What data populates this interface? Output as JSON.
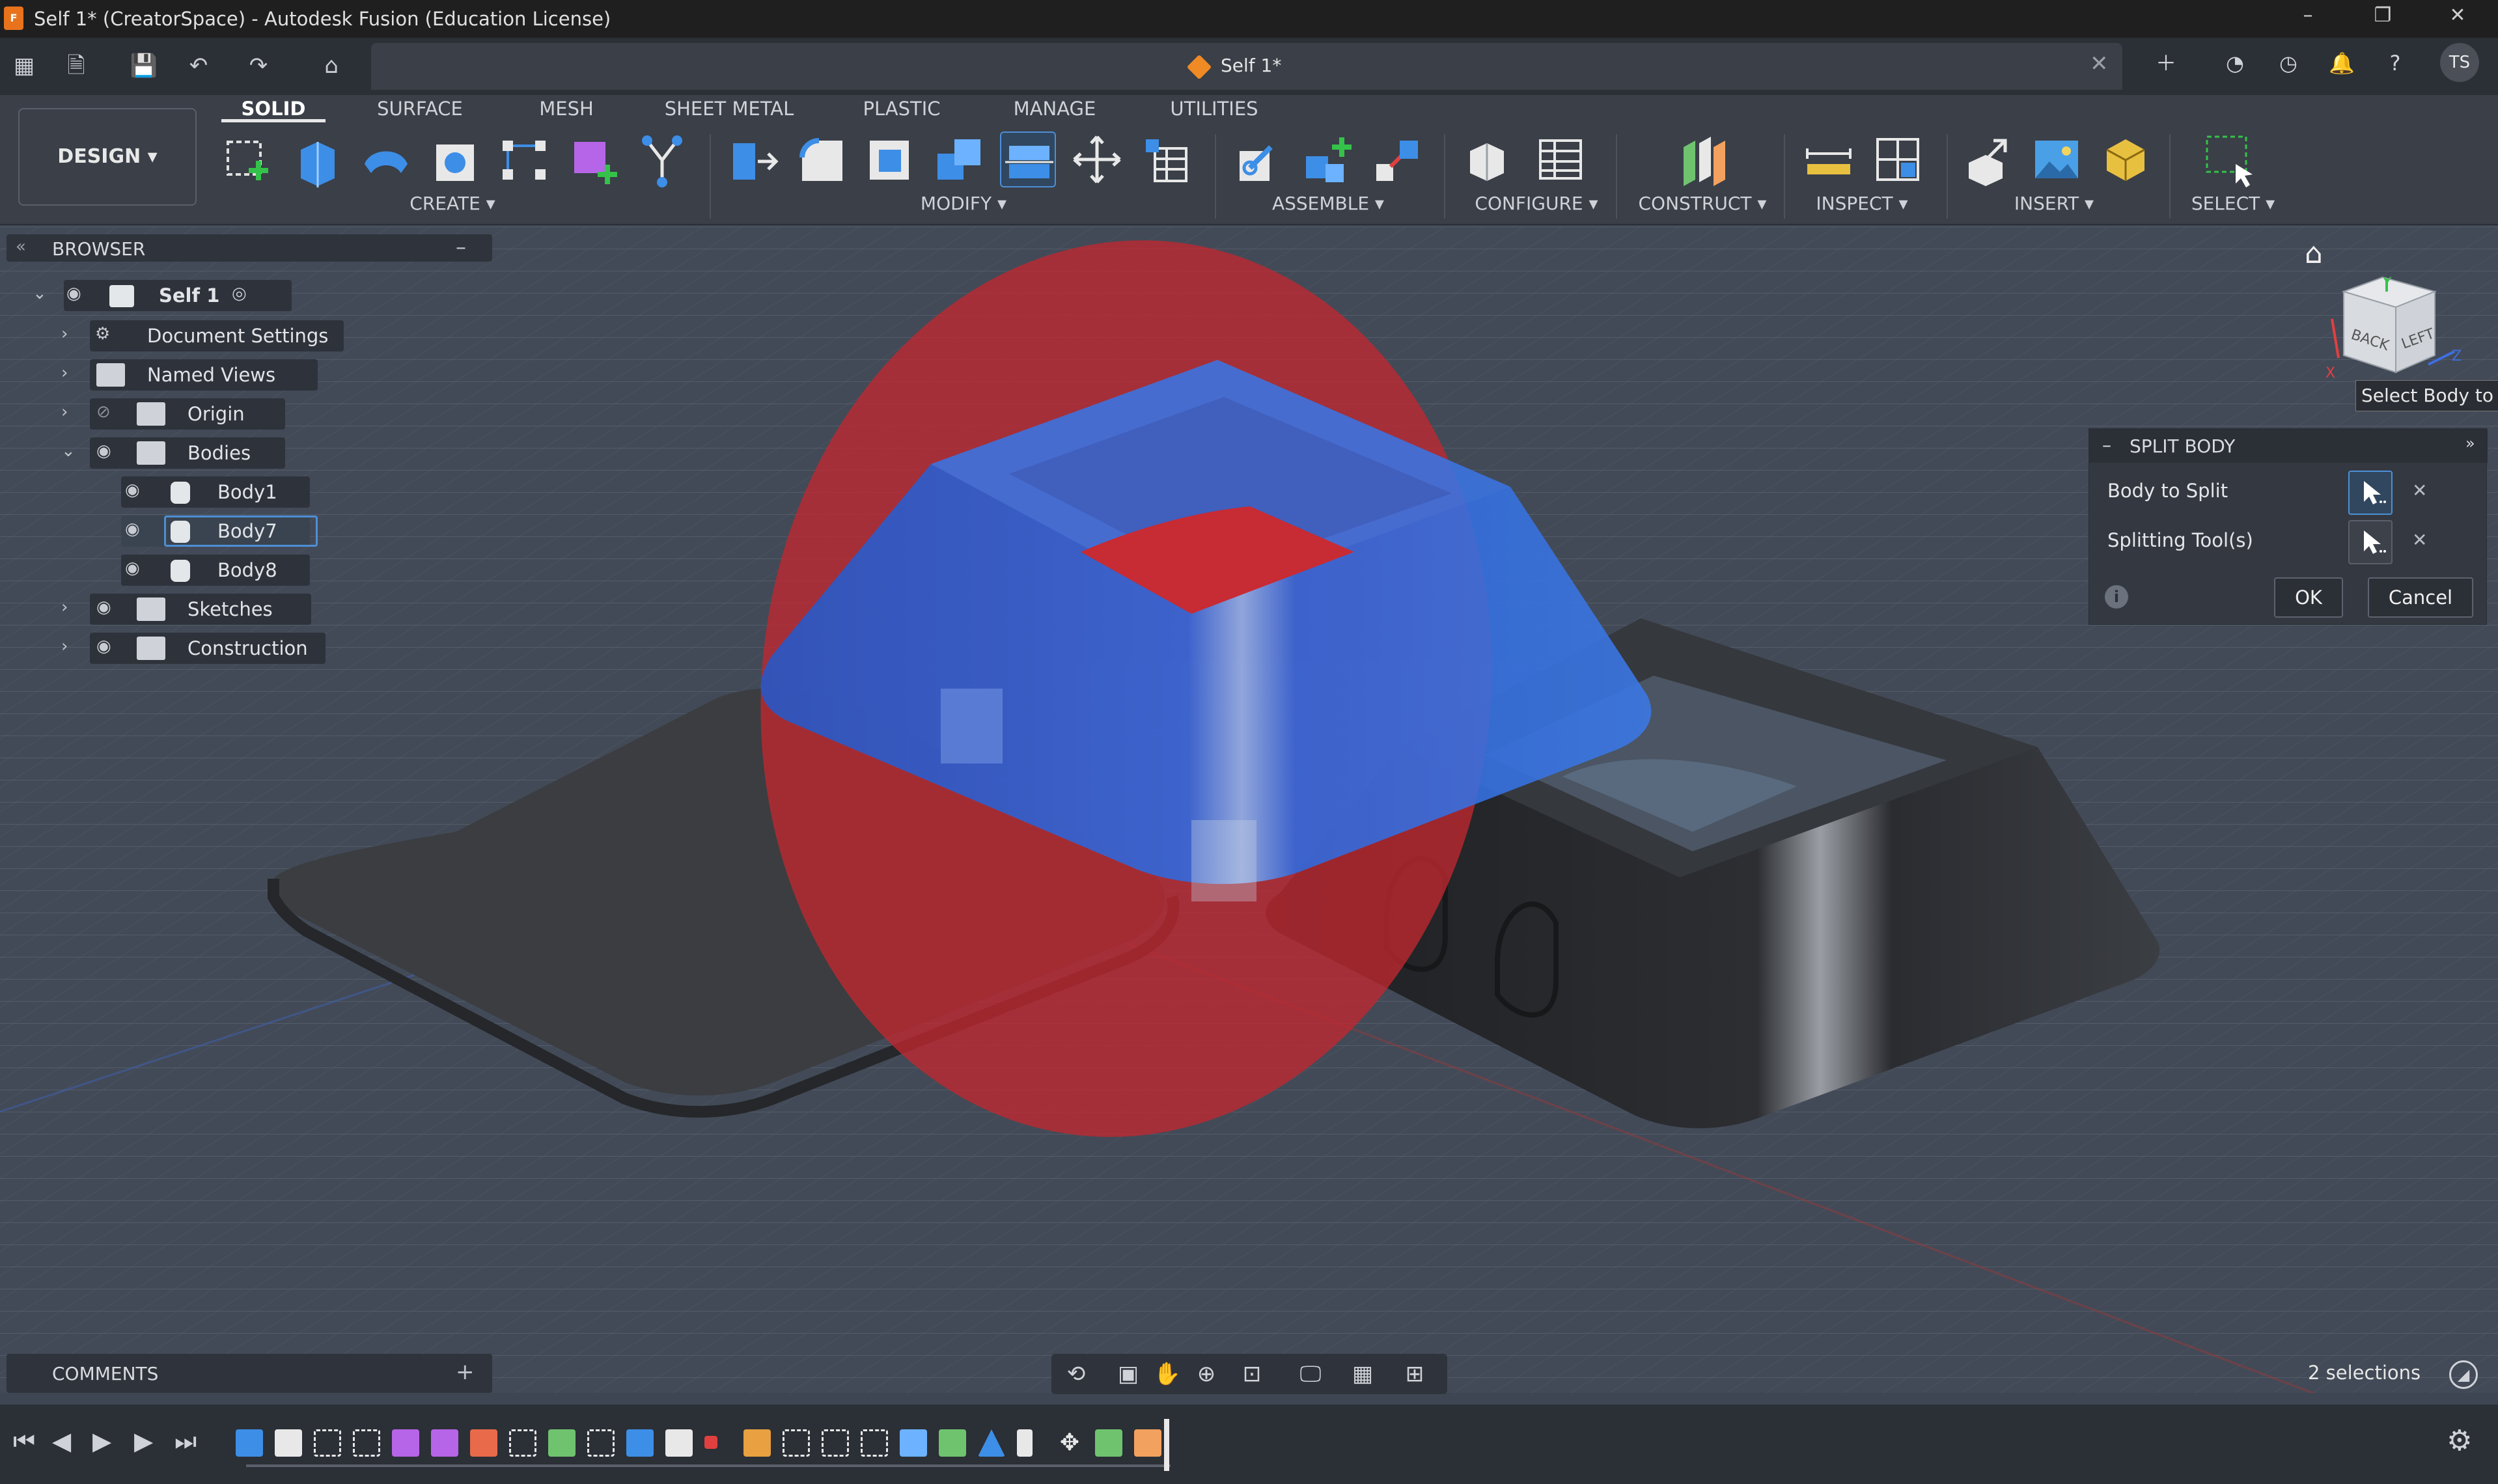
{
  "window": {
    "title": "Self 1* (CreatorSpace) - Autodesk Fusion (Education License)",
    "app_icon": "F"
  },
  "document_tab": {
    "label": "Self 1*"
  },
  "user": {
    "initials": "TS"
  },
  "workspace": {
    "label": "DESIGN ▾"
  },
  "ribbon_tabs": [
    "SOLID",
    "SURFACE",
    "MESH",
    "SHEET METAL",
    "PLASTIC",
    "MANAGE",
    "UTILITIES"
  ],
  "ribbon_groups": [
    "CREATE ▾",
    "MODIFY ▾",
    "ASSEMBLE ▾",
    "CONFIGURE ▾",
    "CONSTRUCT ▾",
    "INSPECT ▾",
    "INSERT ▾",
    "SELECT ▾"
  ],
  "browser": {
    "title": "BROWSER",
    "root": "Self 1",
    "items": [
      "Document Settings",
      "Named Views",
      "Origin",
      "Bodies"
    ],
    "bodies": [
      "Body1",
      "Body7",
      "Body8"
    ],
    "folders_after": [
      "Sketches",
      "Construction"
    ]
  },
  "comments": {
    "title": "COMMENTS"
  },
  "status": {
    "selections": "2 selections"
  },
  "split_body": {
    "title": "SPLIT BODY",
    "body_to_split": "Body to Split",
    "splitting_tools": "Splitting Tool(s)",
    "ok": "OK",
    "cancel": "Cancel"
  },
  "viewcube": {
    "back": "BACK",
    "left": "LEFT",
    "axis_x": "X",
    "axis_y": "Y",
    "axis_z": "Z"
  },
  "tooltip": {
    "text": "Select Body to s"
  },
  "colors": {
    "accent": "#4d8fd6",
    "body_blue": "#2f6fe0",
    "plane_red": "#c0282f",
    "body_dark": "#2d2f33"
  }
}
